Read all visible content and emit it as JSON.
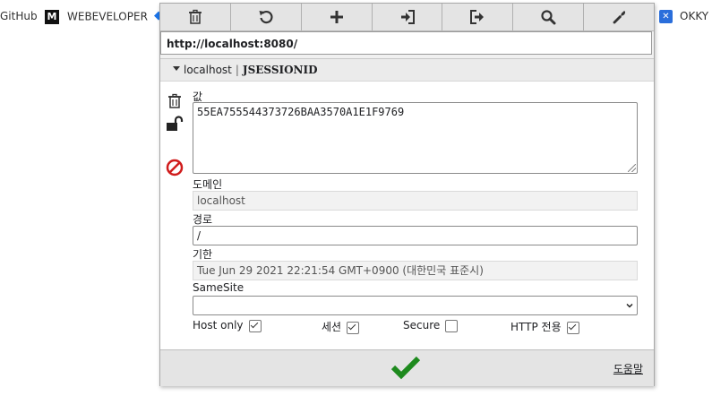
{
  "browser": {
    "bookmarks": [
      {
        "label": "GitHub"
      },
      {
        "label": "WEBEVELOPER",
        "logo": "M"
      },
      {
        "label": "OKKY",
        "logo": "✕"
      }
    ]
  },
  "toolbar": {
    "buttons": [
      {
        "icon": "trash-icon"
      },
      {
        "icon": "undo-icon"
      },
      {
        "icon": "plus-icon"
      },
      {
        "icon": "import-icon"
      },
      {
        "icon": "export-icon"
      },
      {
        "icon": "search-icon"
      },
      {
        "icon": "wrench-icon"
      }
    ]
  },
  "url": "http://localhost:8080/",
  "cookie": {
    "domain_header": "localhost",
    "separator": "|",
    "name": "JSESSIONID",
    "value_label": "값",
    "value": "55EA755544373726BAA3570A1E1F9769",
    "domain_label": "도메인",
    "domain": "localhost",
    "path_label": "경로",
    "path": "/",
    "expires_label": "기한",
    "expires": "Tue Jun 29 2021 22:21:54 GMT+0900 (대한민국 표준시)",
    "samesite_label": "SameSite",
    "samesite": "",
    "flags": {
      "host_only_label": "Host only",
      "host_only": true,
      "session_label": "세션",
      "session": true,
      "secure_label": "Secure",
      "secure": false,
      "http_only_label": "HTTP 전용",
      "http_only": true
    }
  },
  "side_icons": [
    "trash-icon",
    "unlock-icon",
    "block-icon"
  ],
  "footer": {
    "save_icon": "checkmark-icon",
    "help_label": "도움말"
  },
  "colors": {
    "checkmark": "#1e8a1e",
    "block_icon": "#d01c1c"
  }
}
